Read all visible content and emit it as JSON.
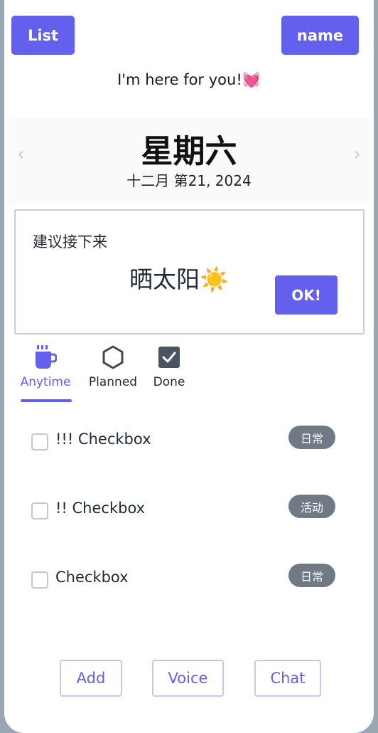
{
  "header": {
    "list_label": "List",
    "name_label": "name",
    "greeting": "I'm here for you!💓"
  },
  "date": {
    "prev_arrow": "‹",
    "next_arrow": "›",
    "weekday": "星期六",
    "date_text": "十二月 第21, 2024"
  },
  "suggestion": {
    "label": "建议接下来",
    "value": "晒太阳☀️",
    "ok_label": "OK!"
  },
  "tabs": [
    {
      "label": "Anytime",
      "icon": "coffee-cup-icon",
      "active": true
    },
    {
      "label": "Planned",
      "icon": "hexagon-icon",
      "active": false
    },
    {
      "label": "Done",
      "icon": "checkbox-checked-icon",
      "active": false
    }
  ],
  "tasks": [
    {
      "label": "!!! Checkbox",
      "tag": "日常",
      "checked": false
    },
    {
      "label": "!! Checkbox",
      "tag": "活动",
      "checked": false
    },
    {
      "label": "Checkbox",
      "tag": "日常",
      "checked": false
    }
  ],
  "footer": {
    "add_label": "Add",
    "voice_label": "Voice",
    "chat_label": "Chat"
  },
  "colors": {
    "accent": "#6260ec",
    "badge": "#707a85",
    "page_bg": "#9aa7b3"
  }
}
